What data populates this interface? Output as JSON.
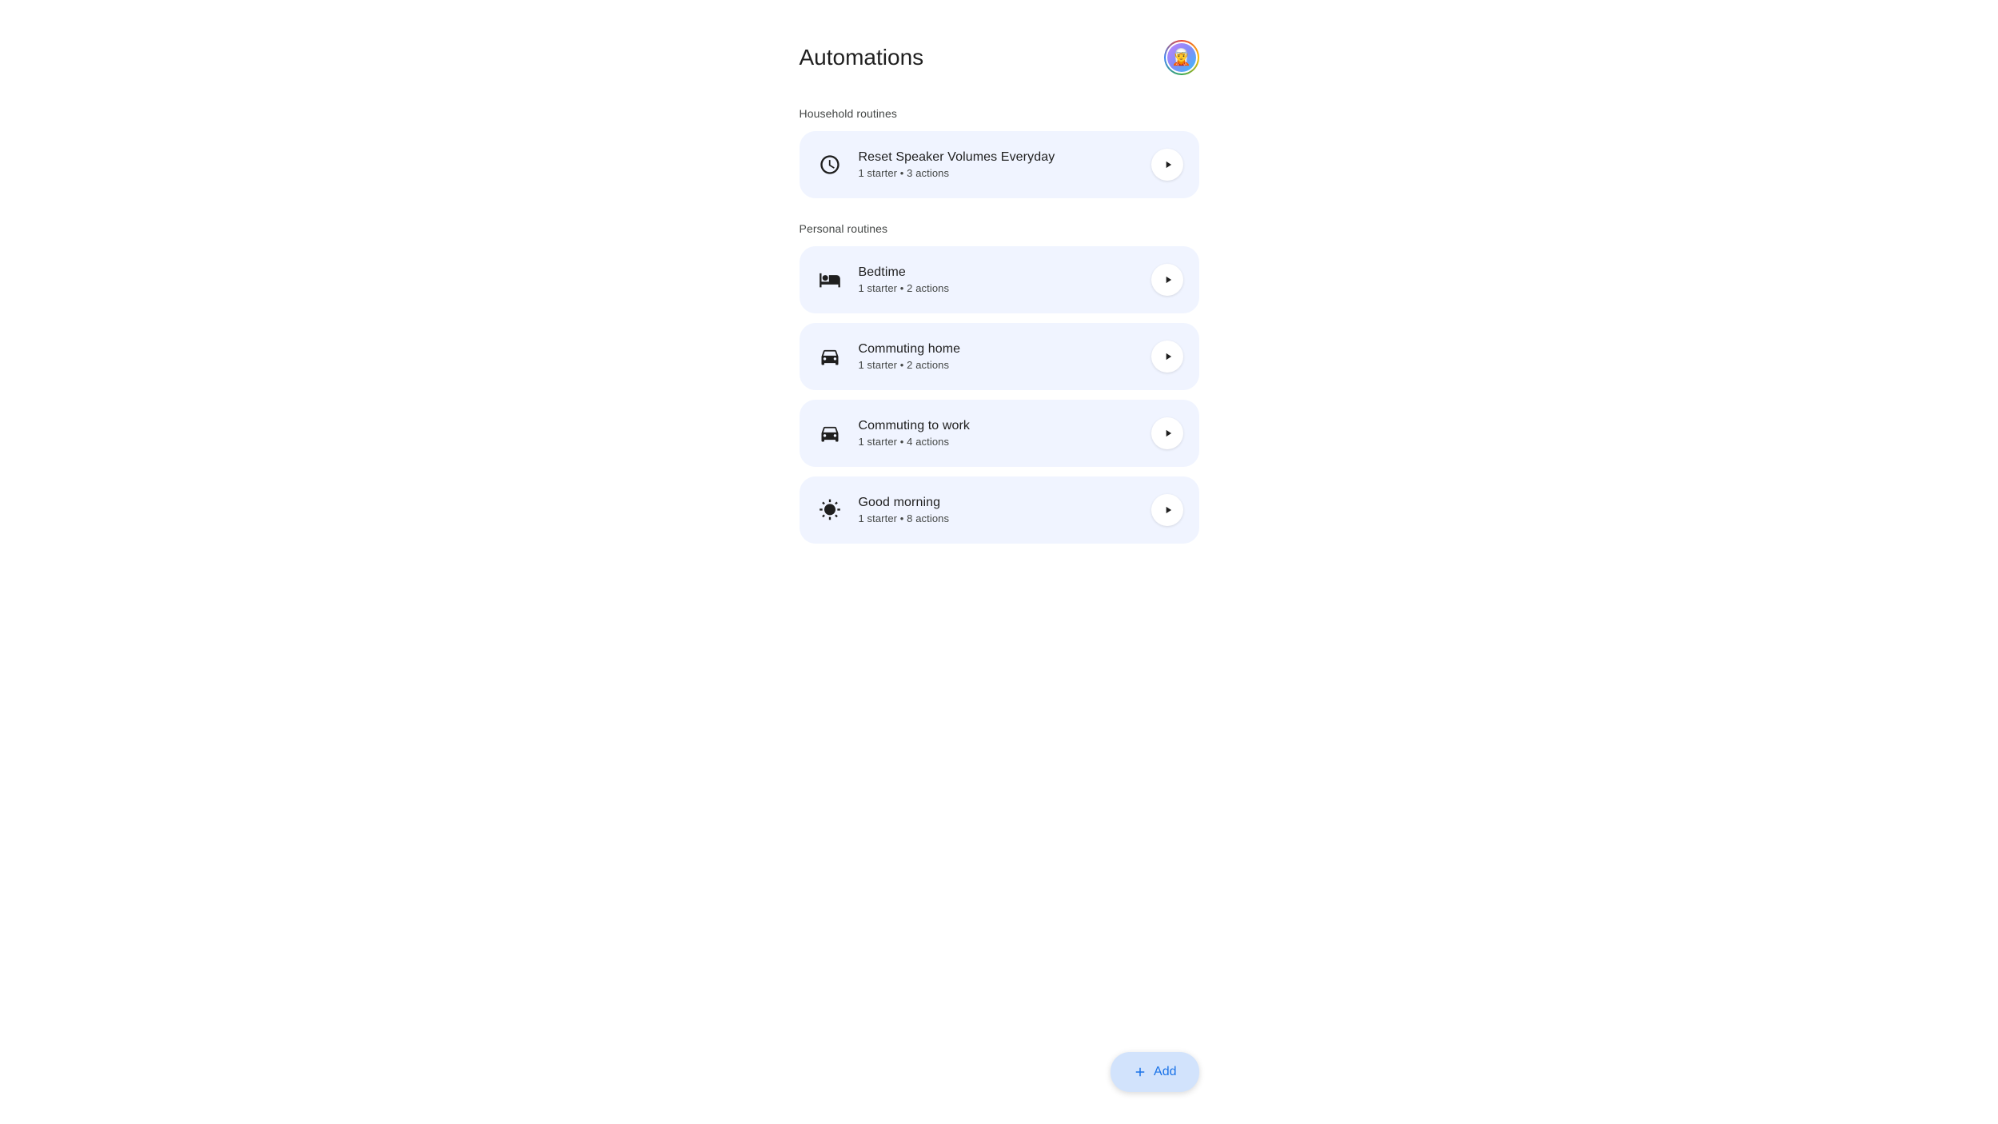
{
  "page": {
    "title": "Automations"
  },
  "avatar": {
    "label": "User avatar",
    "emoji": "🧝"
  },
  "sections": [
    {
      "id": "household",
      "title": "Household routines",
      "routines": [
        {
          "id": "reset-speaker",
          "name": "Reset Speaker Volumes Everyday",
          "meta": "1 starter • 3 actions",
          "icon": "clock"
        }
      ]
    },
    {
      "id": "personal",
      "title": "Personal routines",
      "routines": [
        {
          "id": "bedtime",
          "name": "Bedtime",
          "meta": "1 starter • 2 actions",
          "icon": "bed"
        },
        {
          "id": "commuting-home",
          "name": "Commuting home",
          "meta": "1 starter • 2 actions",
          "icon": "car-home"
        },
        {
          "id": "commuting-work",
          "name": "Commuting to work",
          "meta": "1 starter • 4 actions",
          "icon": "car-work"
        },
        {
          "id": "good-morning",
          "name": "Good morning",
          "meta": "1 starter • 8 actions",
          "icon": "sun"
        }
      ]
    }
  ],
  "add_button": {
    "label": "+ Add"
  }
}
